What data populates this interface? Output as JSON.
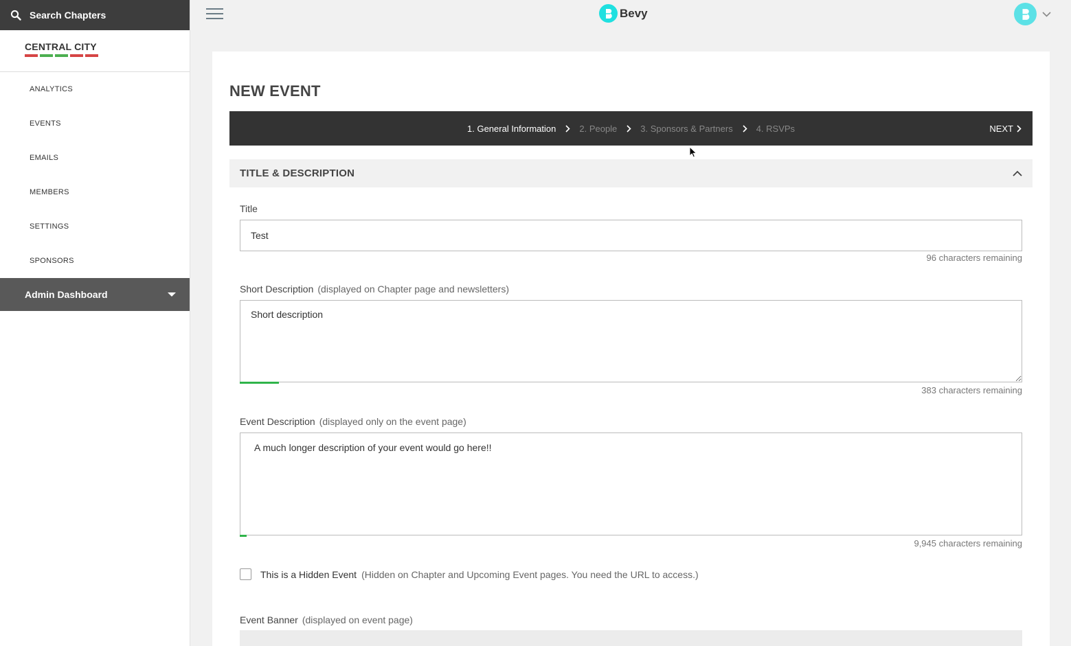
{
  "sidebar": {
    "search_label": "Search Chapters",
    "chapter_name": "CENTRAL CITY",
    "chapter_stripe_colors": [
      "#d64545",
      "#4caf50",
      "#4caf50",
      "#d64545",
      "#d64545"
    ],
    "nav_items": [
      {
        "label": "ANALYTICS"
      },
      {
        "label": "EVENTS"
      },
      {
        "label": "EMAILS"
      },
      {
        "label": "MEMBERS"
      },
      {
        "label": "SETTINGS"
      },
      {
        "label": "SPONSORS"
      }
    ],
    "admin_label": "Admin Dashboard"
  },
  "header": {
    "brand": "Bevy",
    "brand_color": "#1fe0e0"
  },
  "page": {
    "title": "NEW EVENT",
    "steps": [
      {
        "label": "1. General Information",
        "active": true
      },
      {
        "label": "2. People",
        "active": false
      },
      {
        "label": "3. Sponsors & Partners",
        "active": false
      },
      {
        "label": "4. RSVPs",
        "active": false
      }
    ],
    "next_label": "NEXT",
    "section_title": "TITLE & DESCRIPTION",
    "title_field": {
      "label": "Title",
      "value": "Test",
      "remaining": "96 characters remaining"
    },
    "short_desc": {
      "label": "Short Description",
      "hint": "(displayed on Chapter page and newsletters)",
      "value": "Short description",
      "remaining": "383 characters remaining",
      "fill_fraction": 0.05
    },
    "event_desc": {
      "label": "Event Description",
      "hint": "(displayed only on the event page)",
      "value": "A much longer description of your event would go here!!",
      "remaining": "9,945 characters remaining",
      "fill_fraction": 0.009
    },
    "hidden_event": {
      "label": "This is a Hidden Event",
      "hint": "(Hidden on Chapter and Upcoming Event pages. You need the URL to access.)",
      "checked": false
    },
    "banner": {
      "label": "Event Banner",
      "hint": "(displayed on event page)"
    }
  }
}
